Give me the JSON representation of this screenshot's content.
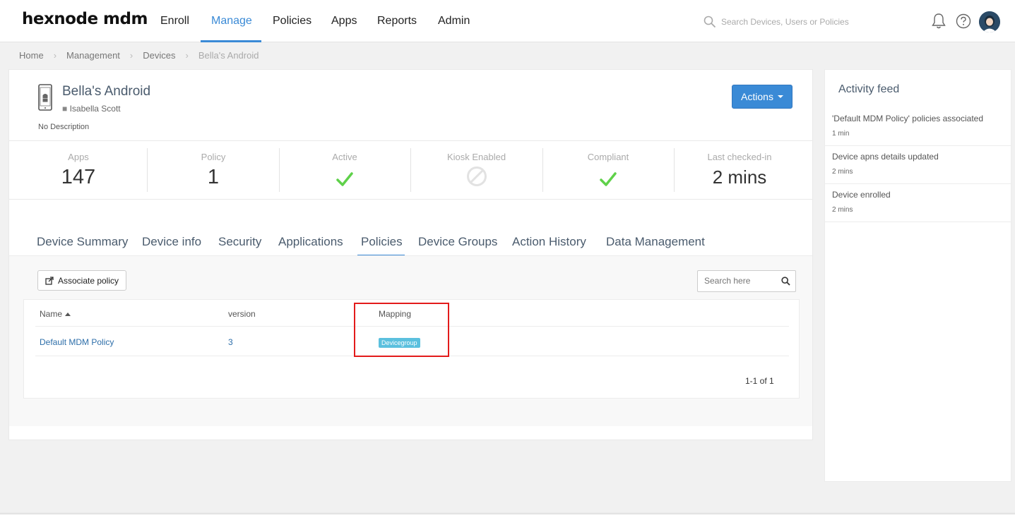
{
  "brand": {
    "name": "hexnode mdm",
    "accent": "#3a8ad6"
  },
  "nav": {
    "items": [
      {
        "label": "Enroll"
      },
      {
        "label": "Manage"
      },
      {
        "label": "Policies"
      },
      {
        "label": "Apps"
      },
      {
        "label": "Reports"
      },
      {
        "label": "Admin"
      }
    ],
    "active": "Manage",
    "search_placeholder": "Search Devices, Users or Policies"
  },
  "breadcrumb": [
    "Home",
    "Management",
    "Devices",
    "Bella's Android"
  ],
  "device": {
    "name": "Bella's Android",
    "user": "Isabella Scott",
    "description": "No Description",
    "actions_label": "Actions"
  },
  "stats": [
    {
      "label": "Apps",
      "value": "147"
    },
    {
      "label": "Policy",
      "value": "1"
    },
    {
      "label": "Active",
      "icon": "check-icon"
    },
    {
      "label": "Kiosk Enabled",
      "icon": "ban-icon"
    },
    {
      "label": "Compliant",
      "icon": "check-icon"
    },
    {
      "label": "Last checked-in",
      "value": "2 mins"
    }
  ],
  "tabs": [
    {
      "label": "Device Summary"
    },
    {
      "label": "Device info"
    },
    {
      "label": "Security"
    },
    {
      "label": "Applications"
    },
    {
      "label": "Policies"
    },
    {
      "label": "Device Groups"
    },
    {
      "label": "Action History"
    },
    {
      "label": "Data Management"
    }
  ],
  "active_tab": "Policies",
  "policies": {
    "associate_label": "Associate policy",
    "search_placeholder": "Search here",
    "columns": {
      "name": "Name",
      "version": "version",
      "mapping": "Mapping"
    },
    "rows": [
      {
        "name": "Default MDM Policy",
        "version": "3",
        "mapping": "Devicegroup"
      }
    ],
    "pagination": "1-1 of 1"
  },
  "activity_feed": {
    "title": "Activity feed",
    "items": [
      {
        "text": "'Default MDM Policy' policies associated",
        "time": "1 min"
      },
      {
        "text": "Device apns details updated",
        "time": "2 mins"
      },
      {
        "text": "Device enrolled",
        "time": "2 mins"
      }
    ]
  }
}
